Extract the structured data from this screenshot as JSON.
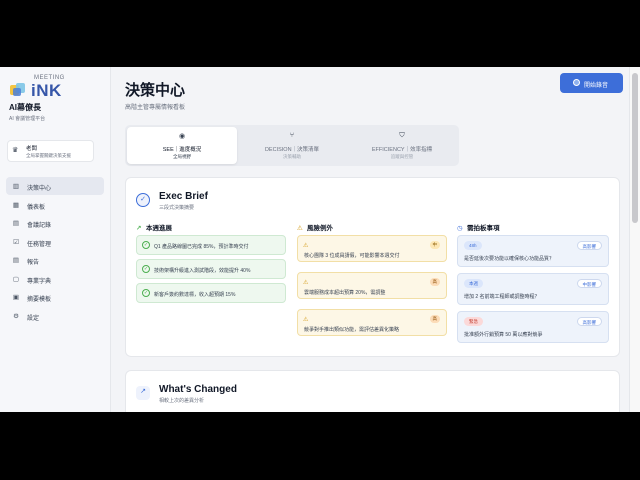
{
  "brand": {
    "meeting": "MEETING",
    "ink": "iNK",
    "app_name": "AI幕僚長",
    "app_sub": "AI 會議管理平台"
  },
  "boss": {
    "title": "老闆",
    "sub": "全局掌握關鍵決策支援"
  },
  "nav": [
    {
      "icon": "chart-bar-icon",
      "glyph": "▥",
      "label": "決策中心",
      "active": true
    },
    {
      "icon": "dashboard-icon",
      "glyph": "▦",
      "label": "儀表板"
    },
    {
      "icon": "document-icon",
      "glyph": "▤",
      "label": "會議記錄"
    },
    {
      "icon": "checklist-icon",
      "glyph": "☑",
      "label": "任務管理"
    },
    {
      "icon": "report-icon",
      "glyph": "▤",
      "label": "報告"
    },
    {
      "icon": "book-icon",
      "glyph": "▢",
      "label": "專業字典"
    },
    {
      "icon": "template-icon",
      "glyph": "▣",
      "label": "摘要模板"
    },
    {
      "icon": "gear-icon",
      "glyph": "⚙",
      "label": "設定"
    }
  ],
  "header": {
    "title": "決策中心",
    "subtitle": "高階主管專屬情報看板",
    "record_label": "開始錄音"
  },
  "tabs": [
    {
      "icon": "eye-icon",
      "glyph": "◉",
      "label": "SEE｜進度概況",
      "sub": "全局視野",
      "active": true
    },
    {
      "icon": "branch-icon",
      "glyph": "⑂",
      "label": "DECISION｜決策清單",
      "sub": "決策輔助"
    },
    {
      "icon": "shield-icon",
      "glyph": "⛉",
      "label": "EFFICIENCY｜效率指標",
      "sub": "追蹤與控管"
    }
  ],
  "brief": {
    "title": "Exec Brief",
    "sub": "三段式決策摘要",
    "col1": {
      "title": "本週進展",
      "items": [
        "Q1 產品路線圖已完成 85%，預計準時交付",
        "技術架構升級進入測試階段，效能提升 40%",
        "新客戶簽約數達標，收入超預期 15%"
      ]
    },
    "col2": {
      "title": "風險例外",
      "items": [
        {
          "text": "核心團隊 3 位成員請假，可能影響本週交付",
          "level": "中"
        },
        {
          "text": "雲端服務成本超出預算 20%，需調整",
          "level": "高"
        },
        {
          "text": "競爭對手推出類似功能，需評估差異化策略",
          "level": "高"
        }
      ]
    },
    "col3": {
      "title": "需拍板事項",
      "items": [
        {
          "tag": "48h",
          "impact": "高影響",
          "text": "是否延後次要功能以確保核心功能品質？",
          "tag_color": "blue"
        },
        {
          "tag": "本週",
          "impact": "中影響",
          "text": "增加 2 名前端工程師或調整時程？",
          "tag_color": "blue"
        },
        {
          "tag": "緊急",
          "impact": "高影響",
          "text": "批准額外行銷預算 50 萬以應對競爭",
          "tag_color": "red"
        }
      ]
    }
  },
  "changed": {
    "title": "What's Changed",
    "sub": "相較上次的差異分析"
  }
}
